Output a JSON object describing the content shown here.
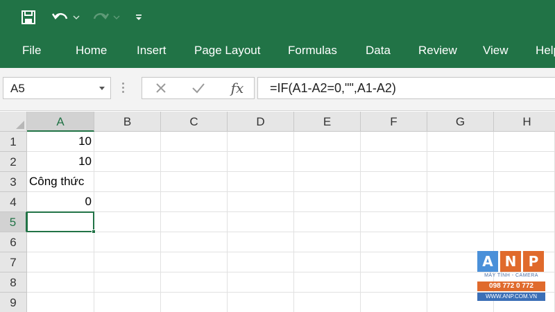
{
  "quick_access": {
    "save_icon": "save-icon",
    "undo_icon": "undo-icon",
    "redo_icon": "redo-icon",
    "customize_icon": "customize-qat-icon"
  },
  "ribbon": {
    "tabs": [
      "File",
      "Home",
      "Insert",
      "Page Layout",
      "Formulas",
      "Data",
      "Review",
      "View",
      "Help"
    ]
  },
  "formula_bar": {
    "name_box": "A5",
    "cancel_icon": "cancel-icon",
    "enter_icon": "check-icon",
    "fx_label": "fx",
    "formula": "=IF(A1-A2=0,\"\",A1-A2)"
  },
  "sheet": {
    "columns": [
      "A",
      "B",
      "C",
      "D",
      "E",
      "F",
      "G",
      "H"
    ],
    "rows": [
      "1",
      "2",
      "3",
      "4",
      "5",
      "6",
      "7",
      "8",
      "9"
    ],
    "selected_cell": "A5",
    "cells": {
      "A1": "10",
      "A2": "10",
      "A3": "Công thức",
      "A4": "0",
      "A5": ""
    }
  },
  "watermark": {
    "letters": [
      "A",
      "N",
      "P"
    ],
    "tagline": "MÁY TÍNH - CAMERA",
    "phone": "098 772 0 772",
    "website": "WWW.ANP.COM.VN"
  },
  "colors": {
    "excel_green": "#217346",
    "logo_a": "#4a90d9",
    "logo_n": "#e06a2c",
    "logo_p": "#e06a2c"
  }
}
